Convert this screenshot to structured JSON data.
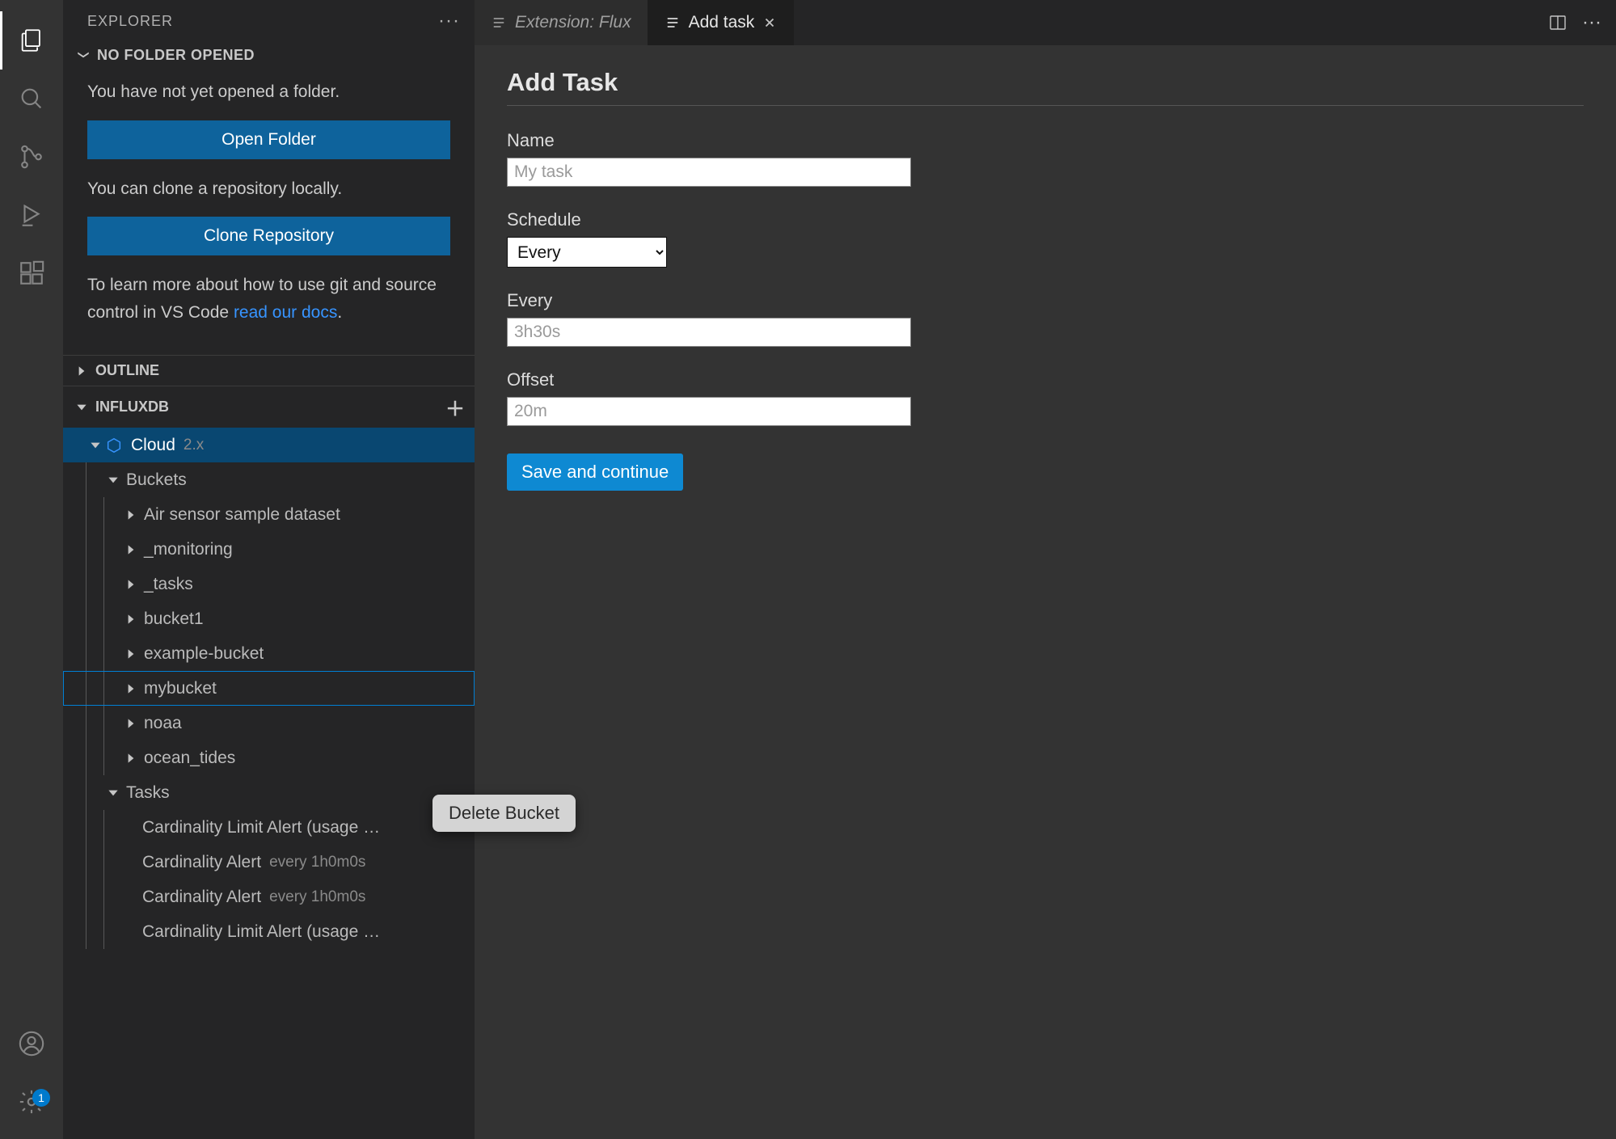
{
  "activity": {
    "settings_badge": "1"
  },
  "sidebar": {
    "title": "EXPLORER",
    "no_folder_heading": "NO FOLDER OPENED",
    "no_folder_msg": "You have not yet opened a folder.",
    "open_folder_btn": "Open Folder",
    "clone_msg": "You can clone a repository locally.",
    "clone_btn": "Clone Repository",
    "git_msg_prefix": "To learn more about how to use git and source control in VS Code ",
    "git_link": "read our docs",
    "outline_heading": "OUTLINE",
    "influx_heading": "INFLUXDB",
    "cloud_label": "Cloud",
    "cloud_version": "2.x",
    "buckets_label": "Buckets",
    "buckets": [
      "Air sensor sample dataset",
      "_monitoring",
      "_tasks",
      "bucket1",
      "example-bucket",
      "mybucket",
      "noaa",
      "ocean_tides"
    ],
    "tasks_label": "Tasks",
    "tasks": [
      {
        "name": "Cardinality Limit Alert (usage …",
        "badge": ""
      },
      {
        "name": "Cardinality Alert",
        "badge": "every 1h0m0s"
      },
      {
        "name": "Cardinality Alert",
        "badge": "every 1h0m0s"
      },
      {
        "name": "Cardinality Limit Alert (usage …",
        "badge": ""
      }
    ]
  },
  "context_menu": {
    "delete_bucket": "Delete Bucket"
  },
  "tabs": {
    "tab1": "Extension: Flux",
    "tab2": "Add task"
  },
  "form": {
    "heading": "Add Task",
    "name_label": "Name",
    "name_placeholder": "My task",
    "schedule_label": "Schedule",
    "schedule_value": "Every",
    "every_label": "Every",
    "every_placeholder": "3h30s",
    "offset_label": "Offset",
    "offset_placeholder": "20m",
    "save_btn": "Save and continue"
  }
}
